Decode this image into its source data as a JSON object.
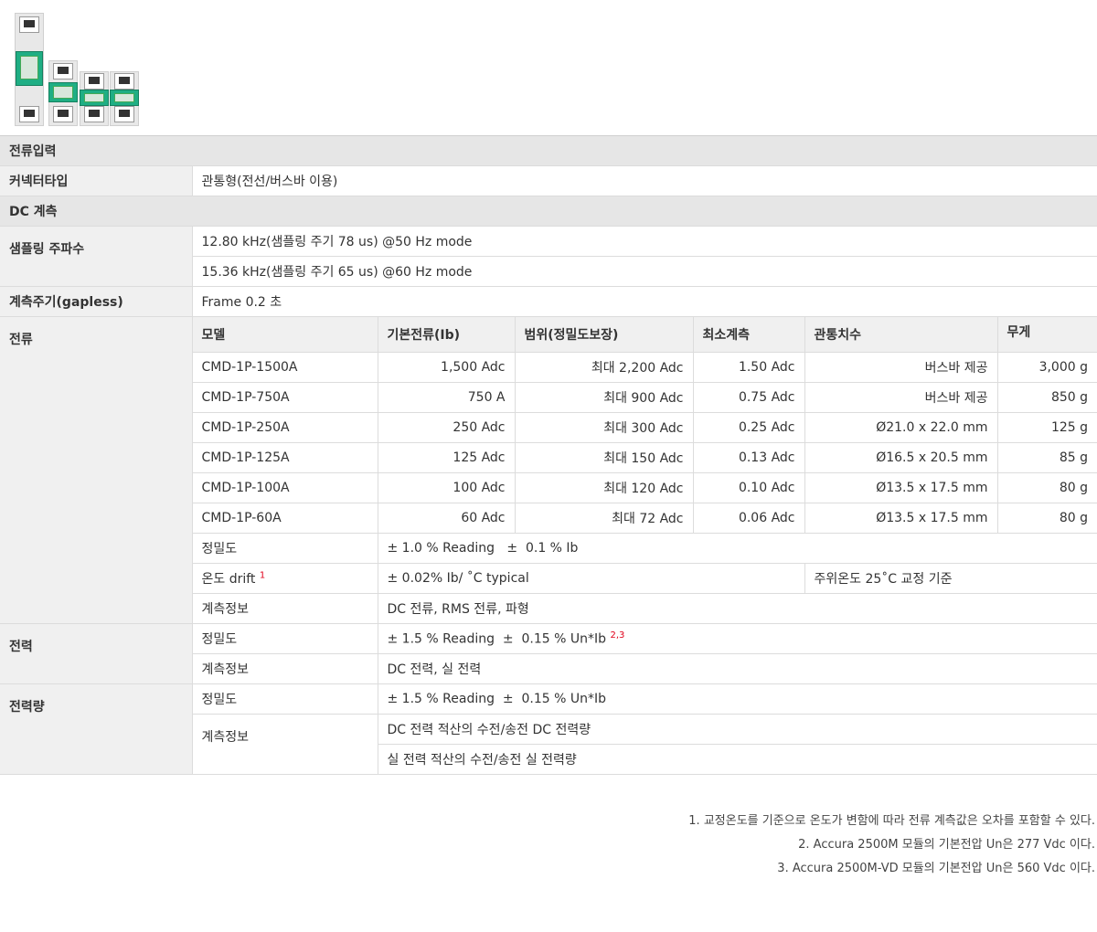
{
  "sections": {
    "current_input": "전류입력",
    "dc_measure": "DC 계측"
  },
  "connector": {
    "label": "커넥터타입",
    "value": "관통형(전선/버스바 이용)"
  },
  "sampling": {
    "label": "샘플링 주파수",
    "rows": [
      "12.80 kHz(샘플링 주기 78 us) @50 Hz mode",
      "15.36 kHz(샘플링 주기 65 us) @60 Hz mode"
    ]
  },
  "cycle": {
    "label": "계측주기(gapless)",
    "value": "Frame 0.2 초"
  },
  "current": {
    "label": "전류",
    "headers": [
      "모델",
      "기본전류(Ib)",
      "범위(정밀도보장)",
      "최소계측",
      "관통치수",
      "무게"
    ],
    "rows": [
      [
        "CMD-1P-1500A",
        "1,500 Adc",
        "최대 2,200 Adc",
        "1.50 Adc",
        "버스바 제공",
        "3,000 g"
      ],
      [
        "CMD-1P-750A",
        "750 A",
        "최대 900 Adc",
        "0.75 Adc",
        "버스바 제공",
        "850 g"
      ],
      [
        "CMD-1P-250A",
        "250 Adc",
        "최대 300 Adc",
        "0.25 Adc",
        "Ø21.0 x 22.0 mm",
        "125 g"
      ],
      [
        "CMD-1P-125A",
        "125 Adc",
        "최대 150 Adc",
        "0.13 Adc",
        "Ø16.5 x 20.5 mm",
        "85 g"
      ],
      [
        "CMD-1P-100A",
        "100 Adc",
        "최대 120 Adc",
        "0.10 Adc",
        "Ø13.5 x 17.5 mm",
        "80 g"
      ],
      [
        "CMD-1P-60A",
        "60 Adc",
        "최대 72 Adc",
        "0.06 Adc",
        "Ø13.5 x 17.5 mm",
        "80 g"
      ]
    ],
    "accuracy_label": "정밀도",
    "accuracy": "± 1.0 % Reading   ±  0.1 % Ib",
    "drift_label": "온도 drift",
    "drift_sup": "1",
    "drift": "± 0.02% Ib/ ˚C typical",
    "drift_note": "주위온도 25˚C 교정 기준",
    "info_label": "계측정보",
    "info": "DC 전류, RMS 전류, 파형"
  },
  "power": {
    "label": "전력",
    "accuracy_label": "정밀도",
    "accuracy": "± 1.5 % Reading  ±  0.15 % Un*Ib",
    "accuracy_sup": "2,3",
    "info_label": "계측정보",
    "info": "DC 전력, 실 전력"
  },
  "energy": {
    "label": "전력량",
    "accuracy_label": "정밀도",
    "accuracy": "± 1.5 % Reading  ±  0.15 % Un*Ib",
    "info_label": "계측정보",
    "info": [
      "DC 전력 적산의 수전/송전 DC 전력량",
      "실 전력 적산의 수전/송전 실 전력량"
    ]
  },
  "notes": [
    "1. 교정온도를 기준으로 온도가 변함에 따라 전류 계측값은 오차를 포함할 수 있다.",
    "2. Accura 2500M 모듈의 기본전압 Un은 277 Vdc 이다.",
    "3. Accura 2500M-VD 모듈의 기본전압 Un은 560 Vdc 이다."
  ]
}
